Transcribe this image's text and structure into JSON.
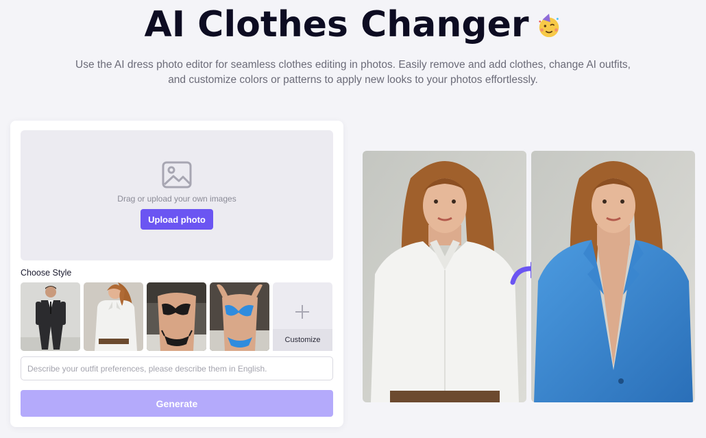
{
  "header": {
    "title": "AI Clothes Changer",
    "title_emoji_icon": "party-face-icon",
    "subtitle_line1": "Use the AI dress photo editor for seamless clothes editing in photos. Easily remove and add clothes, change AI outfits,",
    "subtitle_line2": "and customize colors or patterns to apply new looks to your photos effortlessly."
  },
  "upload": {
    "icon": "image-icon",
    "hint": "Drag or upload your own images",
    "button_label": "Upload photo"
  },
  "styles": {
    "label": "Choose Style",
    "items": [
      {
        "icon": "style-suit-thumbnail"
      },
      {
        "icon": "style-white-shirt-thumbnail"
      },
      {
        "icon": "style-black-lingerie-thumbnail"
      },
      {
        "icon": "style-blue-bikini-thumbnail"
      }
    ],
    "customize_label": "Customize"
  },
  "prompt": {
    "placeholder": "Describe your outfit preferences, please describe them in English.",
    "value": ""
  },
  "generate": {
    "label": "Generate"
  },
  "preview": {
    "before_icon": "before-photo-white-shirt",
    "arrow_icon": "curved-arrow-icon",
    "after_icon": "after-photo-blue-blazer"
  },
  "colors": {
    "accent": "#6b55f2",
    "accent_disabled": "#b4aafb",
    "background": "#f4f4f8"
  }
}
